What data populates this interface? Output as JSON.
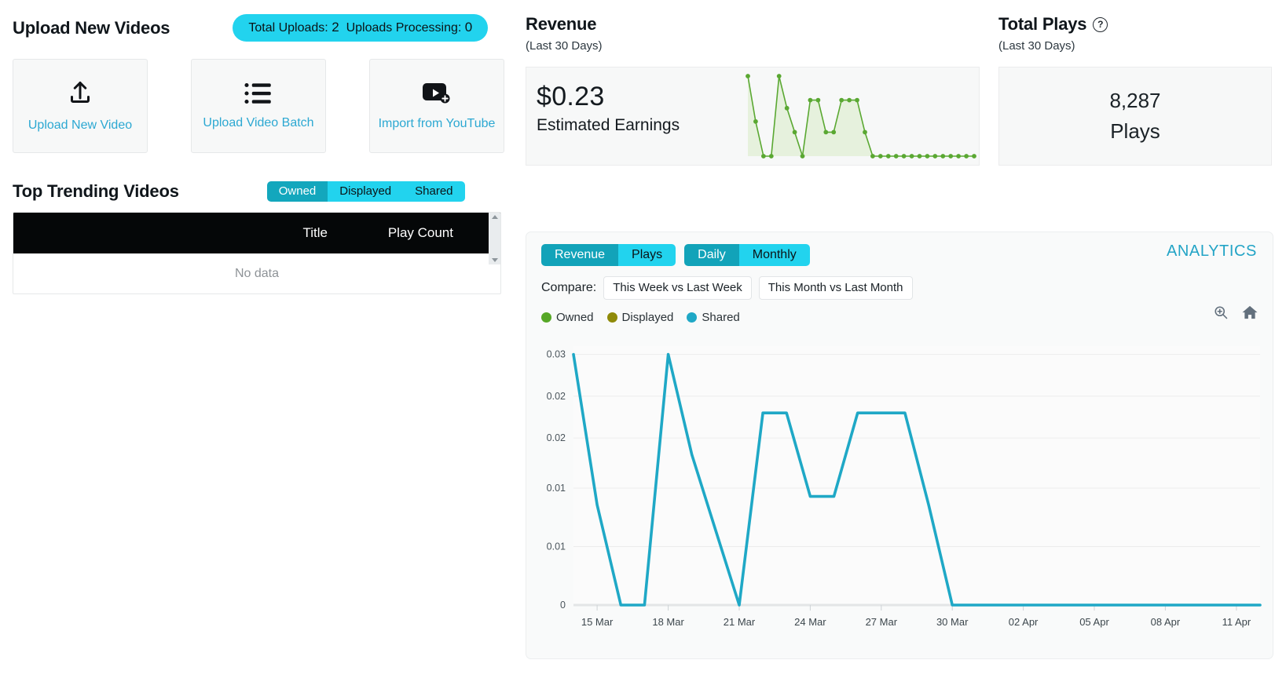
{
  "upload": {
    "title": "Upload New Videos",
    "counts_pill": {
      "total_label": "Total Uploads:",
      "total_value": "2",
      "processing_label": "Uploads Processing:",
      "processing_value": "0"
    },
    "cards": [
      {
        "label": "Upload New Video",
        "icon": "upload-arrow-icon"
      },
      {
        "label": "Upload Video Batch",
        "icon": "list-icon"
      },
      {
        "label": "Import from YouTube",
        "icon": "youtube-plus-icon"
      }
    ]
  },
  "trending": {
    "title": "Top Trending Videos",
    "tabs": [
      {
        "label": "Owned",
        "active": true
      },
      {
        "label": "Displayed",
        "active": false
      },
      {
        "label": "Shared",
        "active": false
      }
    ],
    "columns": [
      "Title",
      "Play Count"
    ],
    "empty_text": "No data",
    "rows": []
  },
  "revenue": {
    "title": "Revenue",
    "subtitle": "(Last 30 Days)",
    "amount": "$0.23",
    "amount_label": "Estimated Earnings",
    "spark_color": "#5aa832",
    "spark_fill": "#e6f1dd"
  },
  "total_plays": {
    "title": "Total Plays",
    "help_icon": "question-mark-icon",
    "subtitle": "(Last 30 Days)",
    "value": "8,287",
    "unit": "Plays"
  },
  "analytics": {
    "panel_label": "ANALYTICS",
    "metric_toggle": [
      {
        "label": "Revenue",
        "active": true
      },
      {
        "label": "Plays",
        "active": false
      }
    ],
    "period_toggle": [
      {
        "label": "Daily",
        "active": true
      },
      {
        "label": "Monthly",
        "active": false
      }
    ],
    "compare_label": "Compare:",
    "compare_buttons": [
      "This Week vs Last Week",
      "This Month vs Last Month"
    ],
    "legend": [
      {
        "label": "Owned",
        "color": "#56a726"
      },
      {
        "label": "Displayed",
        "color": "#8f8a09"
      },
      {
        "label": "Shared",
        "color": "#1fa8c6"
      }
    ],
    "tools": [
      {
        "name": "zoom-in-icon"
      },
      {
        "name": "home-icon"
      }
    ]
  },
  "chart_data": {
    "type": "line",
    "title": "",
    "xlabel": "",
    "ylabel": "",
    "grid": true,
    "legend_position": "top-left",
    "xtick_labels": [
      "15 Mar",
      "18 Mar",
      "21 Mar",
      "24 Mar",
      "27 Mar",
      "30 Mar",
      "02 Apr",
      "05 Apr",
      "08 Apr",
      "11 Apr"
    ],
    "ytick_labels": [
      "0.03",
      "0.02",
      "0.02",
      "0.01",
      "0.01",
      "0"
    ],
    "ytick_values": [
      0.03,
      0.025,
      0.02,
      0.014,
      0.007,
      0
    ],
    "ylim": [
      0,
      0.031
    ],
    "series": [
      {
        "name": "Owned",
        "color": "#1fa8c6",
        "x": [
          "14 Mar",
          "15 Mar",
          "16 Mar",
          "17 Mar",
          "18 Mar",
          "19 Mar",
          "20 Mar",
          "21 Mar",
          "22 Mar",
          "23 Mar",
          "24 Mar",
          "25 Mar",
          "26 Mar",
          "27 Mar",
          "28 Mar",
          "29 Mar",
          "30 Mar",
          "31 Mar",
          "01 Apr",
          "02 Apr",
          "03 Apr",
          "04 Apr",
          "05 Apr",
          "06 Apr",
          "07 Apr",
          "08 Apr",
          "09 Apr",
          "10 Apr",
          "11 Apr",
          "12 Apr"
        ],
        "values": [
          0.03,
          0.012,
          0.0,
          0.0,
          0.03,
          0.018,
          0.009,
          0.0,
          0.023,
          0.023,
          0.013,
          0.013,
          0.023,
          0.023,
          0.023,
          0.012,
          0.0,
          0.0,
          0.0,
          0.0,
          0.0,
          0.0,
          0.0,
          0.0,
          0.0,
          0.0,
          0.0,
          0.0,
          0.0,
          0.0
        ]
      }
    ]
  },
  "revenue_sparkline": {
    "type": "area",
    "color": "#5aa832",
    "values": [
      0.03,
      0.013,
      0.0,
      0.0,
      0.03,
      0.018,
      0.009,
      0.0,
      0.021,
      0.021,
      0.009,
      0.009,
      0.021,
      0.021,
      0.021,
      0.009,
      0.0,
      0.0,
      0.0,
      0.0,
      0.0,
      0.0,
      0.0,
      0.0,
      0.0,
      0.0,
      0.0,
      0.0,
      0.0,
      0.0
    ]
  }
}
